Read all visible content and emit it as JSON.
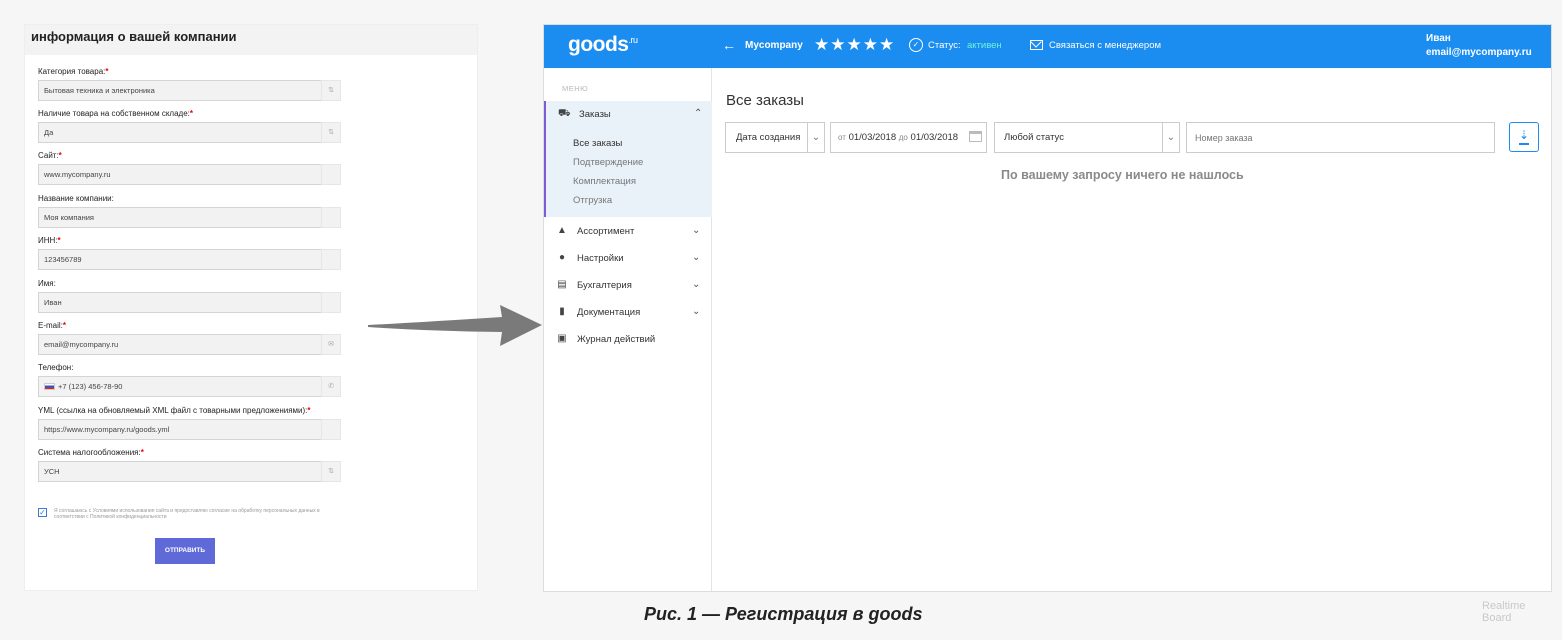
{
  "form": {
    "title": "информация о вашей компании",
    "fields": [
      {
        "label": "Категория товара:",
        "required": "*",
        "value": "Бытовая техника и электроника",
        "side": "⇅"
      },
      {
        "label": "Наличие товара на собственном складе:",
        "required": "*",
        "value": "Да",
        "side": "⇅"
      },
      {
        "label": "Сайт:",
        "required": "*",
        "value": "www.mycompany.ru",
        "side": ""
      },
      {
        "label": "Название компании:",
        "required": "",
        "value": "Моя компания",
        "side": ""
      },
      {
        "label": "ИНН:",
        "required": "*",
        "value": "123456789",
        "side": ""
      },
      {
        "label": "Имя:",
        "required": "",
        "value": "Иван",
        "side": ""
      },
      {
        "label": "E-mail:",
        "required": "*",
        "value": "email@mycompany.ru",
        "side": "✉"
      },
      {
        "label": "Телефон:",
        "required": "",
        "value": "+7 (123) 456-78-90",
        "side": "✆"
      },
      {
        "label": "YML (ссылка на обновляемый XML файл с товарными предложениями):",
        "required": "*",
        "value": "https://www.mycompany.ru/goods.yml",
        "side": ""
      },
      {
        "label": "Система налогообложения:",
        "required": "*",
        "value": "УСН",
        "side": "⇅"
      }
    ],
    "consent_checked": "✓",
    "consent_text": "Я соглашаюсь с Условиями использования сайта и предоставляю согласие на обработку персональных данных в соответствии с Политикой конфиденциальности",
    "submit_label": "ОТПРАВИТЬ"
  },
  "app": {
    "logo": "goods",
    "logo_suffix": ".ru",
    "back_icon": "←",
    "company": "Mycompany",
    "stars": "★★★★★",
    "rating": 5,
    "status_icon": "✓",
    "status_label": "Статус:",
    "status_value": "активен",
    "contact_label": "Связаться с менеджером",
    "user_name": "Иван",
    "user_email": "email@mycompany.ru",
    "accent_color": "#1b8cf0",
    "sidebar": {
      "caption": "МЕНЮ",
      "orders": {
        "icon": "⛟",
        "label": "Заказы",
        "chevron": "⌃"
      },
      "orders_sub": [
        "Все заказы",
        "Подтверждение",
        "Комплектация",
        "Отгрузка"
      ],
      "items": [
        {
          "icon": "▲",
          "label": "Ассортимент",
          "chevron": "⌄"
        },
        {
          "icon": "●",
          "label": "Настройки",
          "chevron": "⌄"
        },
        {
          "icon": "▤",
          "label": "Бухгалтерия",
          "chevron": "⌄"
        },
        {
          "icon": "▮",
          "label": "Документация",
          "chevron": "⌄"
        },
        {
          "icon": "▣",
          "label": "Журнал действий",
          "chevron": ""
        }
      ]
    },
    "main": {
      "title": "Все заказы",
      "date_type": "Дата создания",
      "date_from_label": "от",
      "date_from": "01/03/2018",
      "date_to_label": "до",
      "date_to": "01/03/2018",
      "status_select": "Любой статус",
      "order_placeholder": "Номер заказа",
      "download_icon": "⇣",
      "empty_message": "По вашему запросу ничего не нашлось"
    }
  },
  "caption": "Рис. 1 — Регистрация в goods",
  "watermark": [
    "Realtime",
    "Board"
  ]
}
